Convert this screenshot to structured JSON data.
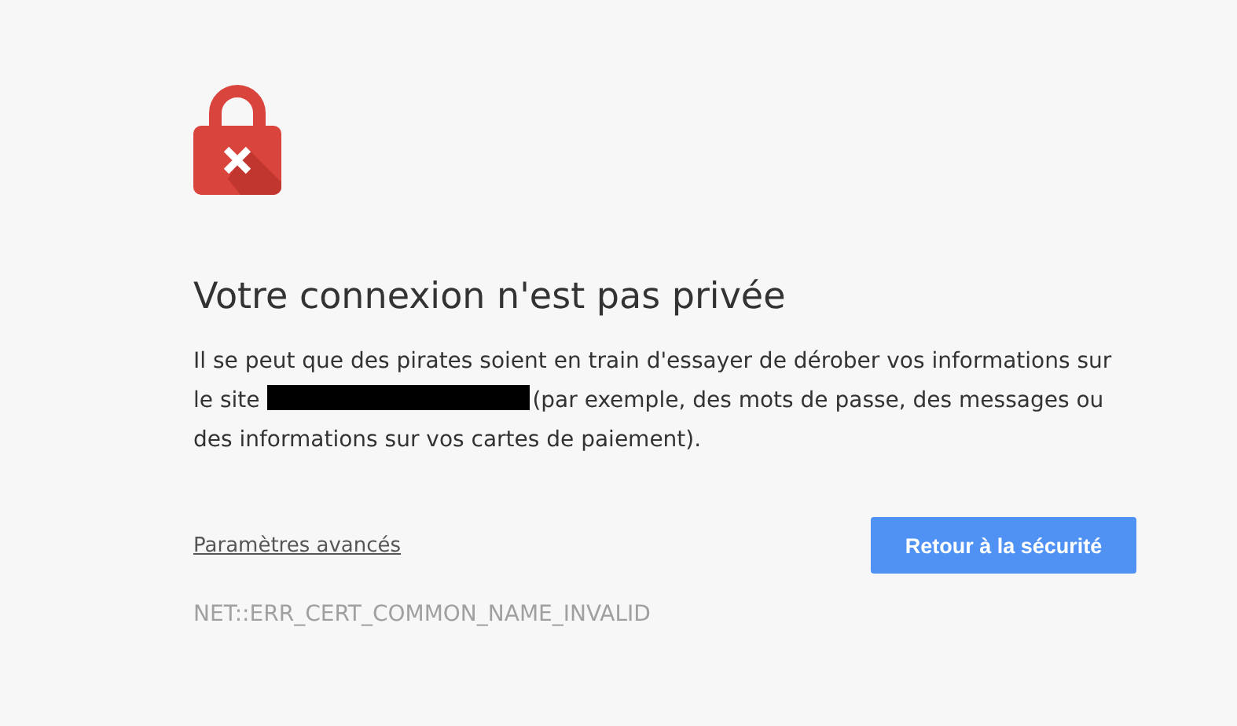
{
  "heading": "Votre connexion n'est pas privée",
  "message": {
    "before": "Il se peut que des pirates soient en train d'essayer de dérober vos informations sur le site",
    "after": "(par exemple, des mots de passe, des messages ou des informations sur vos cartes de paiement)."
  },
  "advanced_link": "Paramètres avancés",
  "back_button": "Retour à la sécurité",
  "error_code": "NET::ERR_CERT_COMMON_NAME_INVALID"
}
